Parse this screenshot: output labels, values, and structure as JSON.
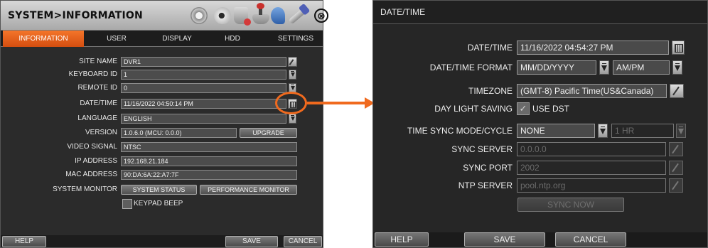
{
  "left": {
    "title": "SYSTEM>INFORMATION",
    "toolbar_icons": [
      "gear-icon",
      "camera-icon",
      "disk-icon",
      "joystick-icon",
      "network-icon",
      "wrench-icon"
    ],
    "close_glyph": "⊗",
    "tabs": [
      {
        "label": "INFORMATION",
        "active": true
      },
      {
        "label": "USER",
        "active": false
      },
      {
        "label": "DISPLAY",
        "active": false
      },
      {
        "label": "HDD",
        "active": false
      },
      {
        "label": "SETTINGS",
        "active": false
      }
    ],
    "fields": {
      "site_name": {
        "label": "SITE NAME",
        "value": "DVR1"
      },
      "keyboard_id": {
        "label": "KEYBOARD ID",
        "value": "1"
      },
      "remote_id": {
        "label": "REMOTE ID",
        "value": "0"
      },
      "datetime": {
        "label": "DATE/TIME",
        "value": "11/16/2022 04:50:14 PM"
      },
      "language": {
        "label": "LANGUAGE",
        "value": "ENGLISH"
      },
      "version": {
        "label": "VERSION",
        "value": "1.0.6.0 (MCU: 0.0.0)",
        "button": "UPGRADE"
      },
      "video_signal": {
        "label": "VIDEO SIGNAL",
        "value": "NTSC"
      },
      "ip_address": {
        "label": "IP ADDRESS",
        "value": "192.168.21.184"
      },
      "mac_address": {
        "label": "MAC ADDRESS",
        "value": "90:DA:6A:22:A7:7F"
      },
      "system_monitor": {
        "label": "SYSTEM MONITOR",
        "status_button": "SYSTEM STATUS",
        "performance_button": "PERFORMANCE MONITOR"
      },
      "keypad_beep": {
        "label": "KEYPAD BEEP",
        "checked": false
      }
    },
    "footer": {
      "help": "HELP",
      "save": "SAVE",
      "cancel": "CANCEL"
    }
  },
  "right": {
    "title": "DATE/TIME",
    "datetime": {
      "label": "DATE/TIME",
      "value": "11/16/2022 04:54:27 PM"
    },
    "format": {
      "label": "DATE/TIME FORMAT",
      "date_format": "MM/DD/YYYY",
      "time_format": "AM/PM"
    },
    "timezone": {
      "label": "TIMEZONE",
      "value": "(GMT-8) Pacific Time(US&Canada)"
    },
    "daylight": {
      "label": "DAY LIGHT SAVING",
      "checkbox_label": "USE DST",
      "checked": true
    },
    "sync_mode": {
      "label": "TIME SYNC MODE/CYCLE",
      "mode": "NONE",
      "cycle": "1 HR"
    },
    "sync_server": {
      "label": "SYNC SERVER",
      "value": "0.0.0.0"
    },
    "sync_port": {
      "label": "SYNC PORT",
      "value": "2002"
    },
    "ntp_server": {
      "label": "NTP SERVER",
      "value": "pool.ntp.org"
    },
    "sync_now": "SYNC NOW",
    "footer": {
      "help": "HELP",
      "save": "SAVE",
      "cancel": "CANCEL"
    }
  },
  "colors": {
    "accent": "#f06a1e",
    "panel_bg": "#2b2b2b",
    "field_bg": "#4c4c4c",
    "tab_active": "#e3601c"
  }
}
